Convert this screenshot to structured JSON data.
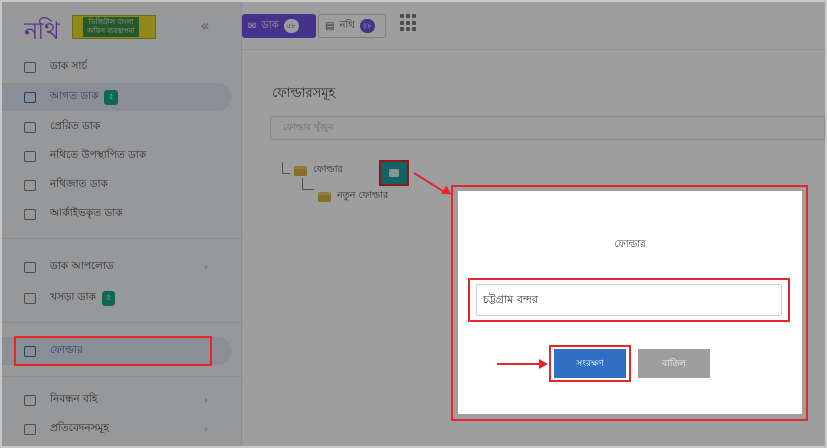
{
  "logo": {
    "text": "নথি",
    "tagline": "ডিজিটাল বাংলা অফিস ব্যবস্থাপনা"
  },
  "sidebar": {
    "collapse_icon": "double-chevron-left-icon",
    "items": [
      {
        "label": "ডাক সার্চ",
        "icon": "search-icon"
      },
      {
        "label": "আগত ডাক",
        "icon": "inbox-icon",
        "badge": "৫"
      },
      {
        "label": "প্রেরিত ডাক",
        "icon": "send-icon"
      },
      {
        "label": "নথিতে উপস্থাপিত ডাক",
        "icon": "upload-icon"
      },
      {
        "label": "নথিজাত ডাক",
        "icon": "folder-icon"
      },
      {
        "label": "আর্কাইভকৃত ডাক",
        "icon": "archive-icon"
      },
      {
        "label": "ডাক আপলোড",
        "icon": "cloud-icon"
      },
      {
        "label": "খসড়া ডাক",
        "icon": "draft-icon",
        "badge": "৫"
      },
      {
        "label": "ফোল্ডার",
        "icon": "folder-icon"
      },
      {
        "label": "নিবন্ধন বহি",
        "icon": "book-icon"
      },
      {
        "label": "প্রতিবেদনসমূহ",
        "icon": "report-icon"
      }
    ]
  },
  "topbar": {
    "dak_label": "ডাক",
    "dak_count": "৫৮",
    "nothi_label": "নথি",
    "nothi_count": "৪৮"
  },
  "main": {
    "title": "ফোল্ডারসমূহ",
    "search_placeholder": "ফোল্ডার খুঁজুন",
    "tree": {
      "root": "ফোল্ডার",
      "child": "নতুন ফোল্ডার"
    }
  },
  "modal": {
    "title": "ফোল্ডার",
    "input_value": "চট্টগ্রাম বন্দর",
    "save_label": "সংরক্ষণ",
    "cancel_label": "বাতিল"
  },
  "colors": {
    "accent": "#6f52e0",
    "highlight": "#e5262b",
    "save": "#2f6fc4",
    "teal": "#1ea0a0"
  }
}
